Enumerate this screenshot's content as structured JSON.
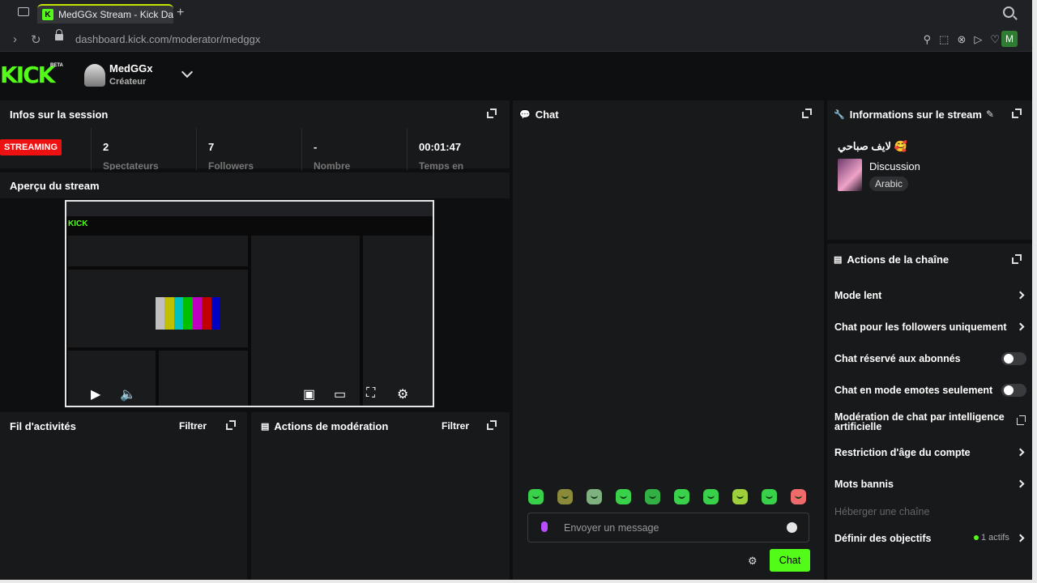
{
  "browser": {
    "tab_title": "MedGGx Stream - Kick Da",
    "tab_favicon": "K",
    "new_tab": "+",
    "url": "dashboard.kick.com/moderator/medggx",
    "profile_initial": "M"
  },
  "header": {
    "logo": "KICK",
    "beta": "BETA",
    "username": "MedGGx",
    "role": "Créateur"
  },
  "session": {
    "title": "Infos sur la session",
    "live_badge": "STREAMING",
    "stats": [
      {
        "value": "2",
        "label": "Spectateurs"
      },
      {
        "value": "7",
        "label": "Followers"
      },
      {
        "value": "-",
        "label": "Nombre"
      },
      {
        "value": "00:01:47",
        "label": "Temps en"
      }
    ]
  },
  "preview": {
    "title": "Aperçu du stream"
  },
  "activity": {
    "title": "Fil d'activités",
    "filter": "Filtrer"
  },
  "modactions": {
    "title": "Actions de modération",
    "filter": "Filtrer"
  },
  "chat": {
    "title": "Chat",
    "placeholder": "Envoyer un message",
    "send_label": "Chat",
    "emote_count": 10
  },
  "stream_info": {
    "title": "Informations sur le stream",
    "stream_title": "لايف صباحي 🥰",
    "category": "Discussion",
    "tag": "Arabic"
  },
  "channel_actions": {
    "title": "Actions de la chaîne",
    "items": {
      "slow": "Mode lent",
      "followers": "Chat pour les followers uniquement",
      "subs": "Chat réservé aux abonnés",
      "emotes": "Chat en mode emotes seulement",
      "ai_line1": "Modération de chat par intelligence",
      "ai_line2": "artificielle",
      "age": "Restriction d'âge du compte",
      "banned": "Mots bannis",
      "host": "Héberger une chaîne",
      "goals": "Définir des objectifs",
      "goals_count": "1 actifs"
    }
  },
  "colors": {
    "accent": "#53fc18",
    "live": "#e11111",
    "panel": "#18191b"
  }
}
